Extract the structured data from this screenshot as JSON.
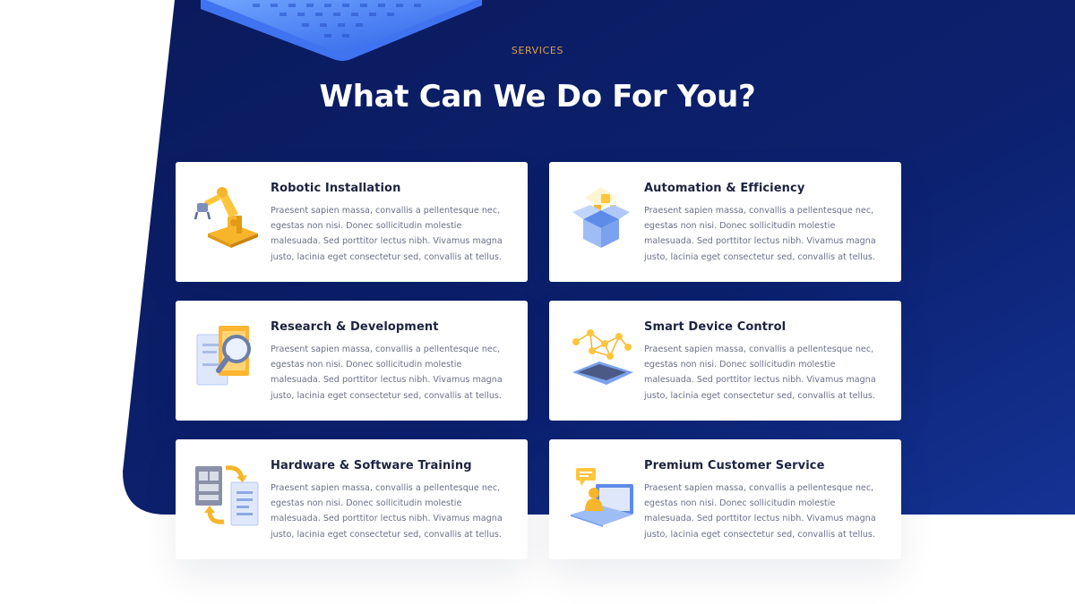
{
  "section": {
    "eyebrow": "SERVICES",
    "title": "What Can We Do For You?"
  },
  "colors": {
    "navy_dark": "#0a1a5c",
    "navy_light": "#123088",
    "accent_gold": "#d7a24a",
    "card_bg": "#ffffff"
  },
  "services": [
    {
      "title": "Robotic Installation",
      "text": "Praesent sapien massa, convallis a pellentesque nec, egestas non nisi. Donec sollicitudin molestie malesuada. Sed porttitor lectus nibh. Vivamus magna justo, lacinia eget consectetur sed, convallis at tellus.",
      "icon": "robot-arm-icon"
    },
    {
      "title": "Automation & Efficiency",
      "text": "Praesent sapien massa, convallis a pellentesque nec, egestas non nisi. Donec sollicitudin molestie malesuada. Sed porttitor lectus nibh. Vivamus magna justo, lacinia eget consectetur sed, convallis at tellus.",
      "icon": "open-box-icon"
    },
    {
      "title": "Research & Development",
      "text": "Praesent sapien massa, convallis a pellentesque nec, egestas non nisi. Donec sollicitudin molestie malesuada. Sed porttitor lectus nibh. Vivamus magna justo, lacinia eget consectetur sed, convallis at tellus.",
      "icon": "magnifier-document-icon"
    },
    {
      "title": "Smart Device Control",
      "text": "Praesent sapien massa, convallis a pellentesque nec, egestas non nisi. Donec sollicitudin molestie malesuada. Sed porttitor lectus nibh. Vivamus magna justo, lacinia eget consectetur sed, convallis at tellus.",
      "icon": "network-tablet-icon"
    },
    {
      "title": "Hardware & Software Training",
      "text": "Praesent sapien massa, convallis a pellentesque nec, egestas non nisi. Donec sollicitudin molestie malesuada. Sed porttitor lectus nibh. Vivamus magna justo, lacinia eget consectetur sed, convallis at tellus.",
      "icon": "sync-documents-icon"
    },
    {
      "title": "Premium Customer Service",
      "text": "Praesent sapien massa, convallis a pellentesque nec, egestas non nisi. Donec sollicitudin molestie malesuada. Sed porttitor lectus nibh. Vivamus magna justo, lacinia eget consectetur sed, convallis at tellus.",
      "icon": "laptop-support-icon"
    }
  ]
}
